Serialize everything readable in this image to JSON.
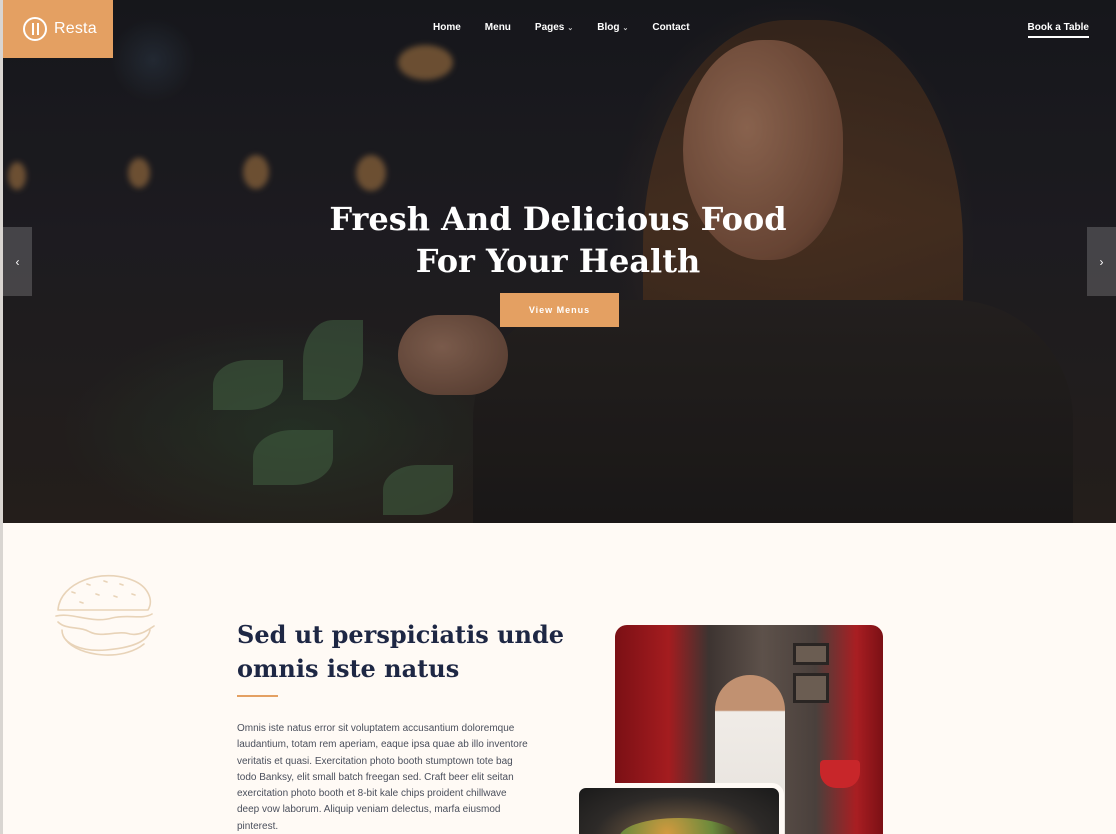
{
  "brand": {
    "name": "Resta",
    "logo_icon": "fork-spoon-icon",
    "accent": "#e4a062"
  },
  "nav": {
    "items": [
      {
        "label": "Home",
        "dropdown": false
      },
      {
        "label": "Menu",
        "dropdown": false
      },
      {
        "label": "Pages",
        "dropdown": true
      },
      {
        "label": "Blog",
        "dropdown": true
      },
      {
        "label": "Contact",
        "dropdown": false
      }
    ],
    "book_label": "Book a Table",
    "caret": "⌄"
  },
  "hero": {
    "title_line1": "Fresh And Delicious Food",
    "title_line2": "For Your Health",
    "button_label": "View Menus",
    "prev_icon": "‹",
    "next_icon": "›"
  },
  "about": {
    "title_line1": "Sed ut perspiciatis unde",
    "title_line2": "omnis iste natus",
    "paragraph_lines": [
      "Omnis iste natus error sit voluptatem accusantium doloremque",
      "laudantium, totam rem aperiam, eaque ipsa quae ab illo inventore",
      "veritatis et quasi. Exercitation photo booth stumptown tote bag",
      "todo Banksy, elit small batch freegan sed. Craft beer elit seitan",
      "exercitation photo booth et 8-bit kale chips proident chillwave",
      "deep vow laborum. Aliquip veniam delectus, marfa eiusmod",
      "pinterest."
    ]
  }
}
